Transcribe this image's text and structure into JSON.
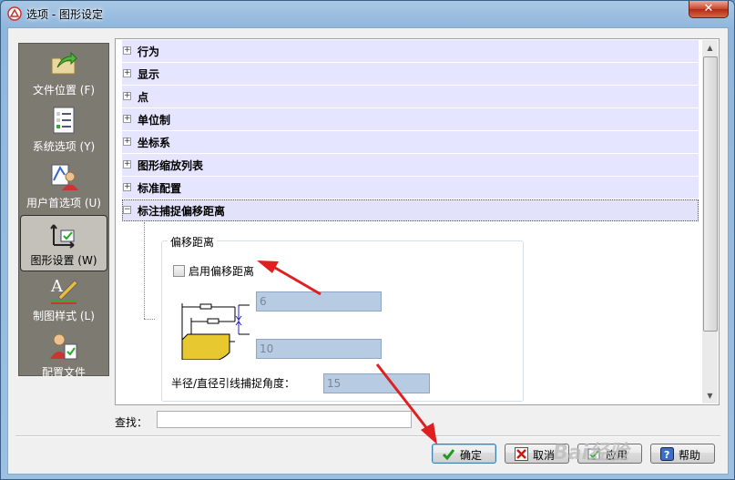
{
  "window": {
    "title": "选项 - 图形设定",
    "close_label": "✕"
  },
  "nav": {
    "items": [
      {
        "label": "文件位置 (F)",
        "icon": "folder-arrow-icon"
      },
      {
        "label": "系统选项 (Y)",
        "icon": "checklist-icon"
      },
      {
        "label": "用户首选项 (U)",
        "icon": "user-preference-icon"
      },
      {
        "label": "图形设置 (W)",
        "icon": "graphics-settings-icon",
        "selected": true
      },
      {
        "label": "制图样式 (L)",
        "icon": "drawing-style-icon"
      },
      {
        "label": "配置文件",
        "icon": "config-file-icon"
      }
    ]
  },
  "tree": {
    "items": [
      {
        "label": "行为",
        "expander": "+"
      },
      {
        "label": "显示",
        "expander": "+"
      },
      {
        "label": "点",
        "expander": "+"
      },
      {
        "label": "单位制",
        "expander": "+"
      },
      {
        "label": "坐标系",
        "expander": "+"
      },
      {
        "label": "图形缩放列表",
        "expander": "+"
      },
      {
        "label": "标准配置",
        "expander": "+"
      },
      {
        "label": "标注捕捉偏移距离",
        "expander": "−"
      }
    ]
  },
  "offset_group": {
    "legend": "偏移距离",
    "enable_label": "启用偏移距离",
    "enable_checked": false,
    "offset1_value": "6",
    "offset2_value": "10",
    "angle_label": "半径/直径引线捕捉角度：",
    "angle_value": "15"
  },
  "search": {
    "label": "查找：",
    "value": ""
  },
  "buttons": {
    "ok": "确定",
    "cancel": "取消",
    "apply": "应用",
    "help": "帮助"
  },
  "watermark": "Bai经验",
  "colors": {
    "tree_row_bg": "#e5e5ff",
    "disabled_field_bg": "#b7cbe2",
    "annotation_red": "#e02020"
  }
}
